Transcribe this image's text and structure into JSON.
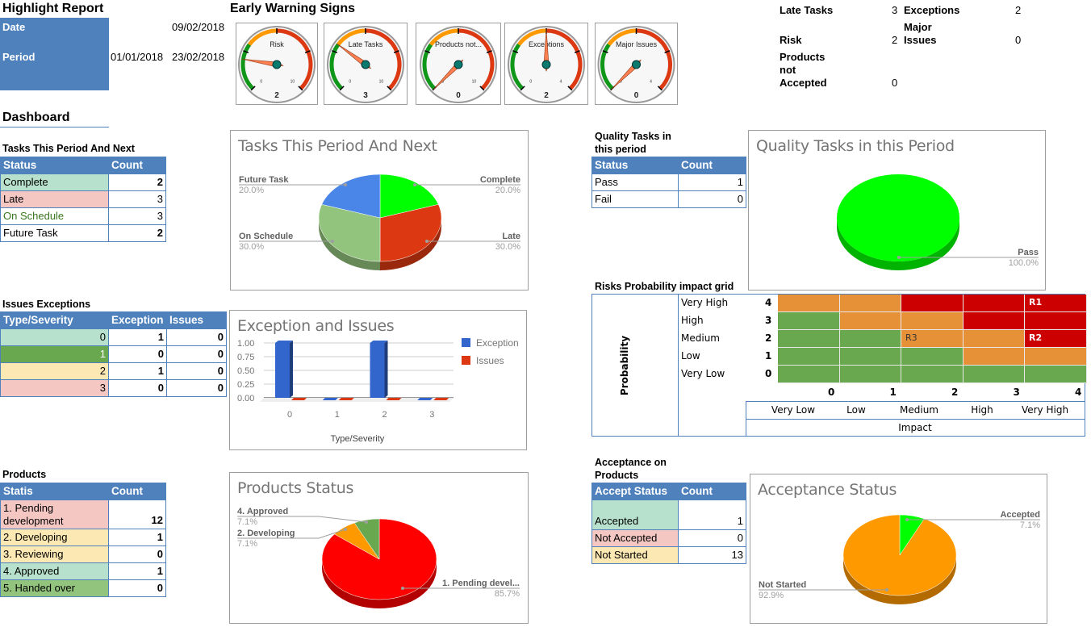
{
  "header": {
    "title": "Highlight Report",
    "date_label": "Date",
    "date_value": "09/02/2018",
    "period_label": "Period",
    "period_start": "01/01/2018",
    "period_end": "23/02/2018",
    "dashboard_label": "Dashboard"
  },
  "warning": {
    "title": "Early Warning Signs",
    "gauges": [
      {
        "label": "Risk",
        "value": 2,
        "display": "2",
        "min": 0,
        "max": 10,
        "min_label": "0",
        "max_label": "10"
      },
      {
        "label": "Late Tasks",
        "value": 3,
        "display": "3",
        "min": 0,
        "max": 10,
        "min_label": "0",
        "max_label": "10"
      },
      {
        "label": "Products not...",
        "value": 0,
        "display": "0",
        "min": 0,
        "max": 10,
        "min_label": "0",
        "max_label": "10"
      },
      {
        "label": "Exceptions",
        "value": 2,
        "display": "2",
        "min": 0,
        "max": 4,
        "min_label": "0",
        "max_label": "4"
      },
      {
        "label": "Major Issues",
        "value": 0,
        "display": "0",
        "min": 0,
        "max": 4,
        "min_label": "0",
        "max_label": "4"
      }
    ],
    "colors": {
      "green": "#109618",
      "orange": "#ff9900",
      "red": "#dc3912",
      "needle": "#ff7f50",
      "hub": "#0b7a6e"
    }
  },
  "summary": {
    "late_tasks_label": "Late Tasks",
    "late_tasks_value": "3",
    "exceptions_label": "Exceptions",
    "exceptions_value": "2",
    "risk_label": "Risk",
    "risk_value": "2",
    "major_label_1": "Major",
    "major_label_2": "Issues",
    "major_value": "0",
    "pna_label_1": "Products",
    "pna_label_2": "not",
    "pna_label_3": "Accepted",
    "pna_value": "0"
  },
  "tasks": {
    "title": "Tasks This Period And Next",
    "col_status": "Status",
    "col_count": "Count",
    "rows": [
      {
        "status": "Complete",
        "count": "2"
      },
      {
        "status": "Late",
        "count": "3"
      },
      {
        "status": "On Schedule",
        "count": "3"
      },
      {
        "status": "Future Task",
        "count": "2"
      }
    ]
  },
  "issues": {
    "title": "Issues Exceptions",
    "col_type": "Type/Severity",
    "col_exception": "Exception",
    "col_issues": "Issues",
    "rows": [
      {
        "type": "0",
        "exception": "1",
        "issues": "0"
      },
      {
        "type": "1",
        "exception": "0",
        "issues": "0"
      },
      {
        "type": "2",
        "exception": "1",
        "issues": "0"
      },
      {
        "type": "3",
        "exception": "0",
        "issues": "0"
      }
    ]
  },
  "products": {
    "title": "Products",
    "col_status": "Statis",
    "col_count": "Count",
    "rows": [
      {
        "status_1": "1. Pending",
        "status_2": "development",
        "count": "12"
      },
      {
        "status": "2. Developing",
        "count": "1"
      },
      {
        "status": "3. Reviewing",
        "count": "0"
      },
      {
        "status": "4. Approved",
        "count": "1"
      },
      {
        "status": "5. Handed over",
        "count": "0"
      }
    ]
  },
  "quality": {
    "title_1": "Quality Tasks in",
    "title_2": "this period",
    "col_status": "Status",
    "col_count": "Count",
    "rows": [
      {
        "status": "Pass",
        "count": "1"
      },
      {
        "status": "Fail",
        "count": "0"
      }
    ]
  },
  "risk_grid": {
    "title": "Risks Probability impact grid",
    "probability_label": "Probability",
    "impact_label": "Impact",
    "prob_levels": [
      "Very High",
      "High",
      "Medium",
      "Low",
      "Very Low"
    ],
    "prob_numbers": [
      "4",
      "3",
      "2",
      "1",
      "0"
    ],
    "impact_numbers": [
      "0",
      "1",
      "2",
      "3",
      "4"
    ],
    "impact_levels": [
      "Very Low",
      "Low",
      "Medium",
      "High",
      "Very High"
    ],
    "cells": [
      [
        "orange",
        "orange",
        "red",
        "red",
        "red"
      ],
      [
        "green",
        "orange",
        "orange",
        "red",
        "red"
      ],
      [
        "green",
        "green",
        "orange",
        "orange",
        "red"
      ],
      [
        "green",
        "green",
        "green",
        "orange",
        "orange"
      ],
      [
        "green",
        "green",
        "green",
        "green",
        "green"
      ]
    ],
    "markers": [
      {
        "id": "R1",
        "row": 0,
        "col": 4
      },
      {
        "id": "R3",
        "row": 2,
        "col": 2
      },
      {
        "id": "R2",
        "row": 2,
        "col": 4
      }
    ],
    "colors": {
      "green": "#6aa84f",
      "orange": "#e69138",
      "red": "#cc0000"
    }
  },
  "acceptance": {
    "title_1": "Acceptance on",
    "title_2": "Products",
    "col_status": "Accept Status",
    "col_count": "Count",
    "rows": [
      {
        "status": "Accepted",
        "count": "1"
      },
      {
        "status": "Not Accepted",
        "count": "0"
      },
      {
        "status": "Not Started",
        "count": "13"
      }
    ]
  },
  "chart_data": [
    {
      "id": "tasks-pie",
      "type": "pie",
      "title": "Tasks This Period And Next",
      "categories": [
        "Complete",
        "Late",
        "On Schedule",
        "Future Task"
      ],
      "values": [
        2,
        3,
        3,
        2
      ],
      "percent_labels": [
        "20.0%",
        "30.0%",
        "30.0%",
        "20.0%"
      ],
      "colors": [
        "#00ff00",
        "#dc3912",
        "#93c47d",
        "#4a86e8"
      ],
      "three_d": true
    },
    {
      "id": "exceptions-bar",
      "type": "bar",
      "title": "Exception and Issues",
      "categories": [
        "0",
        "1",
        "2",
        "3"
      ],
      "series": [
        {
          "name": "Exception",
          "values": [
            1,
            0,
            1,
            0
          ],
          "color": "#3366cc"
        },
        {
          "name": "Issues",
          "values": [
            0,
            0,
            0,
            0
          ],
          "color": "#dc3912"
        }
      ],
      "xlabel": "Type/Severity",
      "ylabel": "",
      "ylim": [
        0,
        1
      ],
      "yticks": [
        "0.00",
        "0.25",
        "0.50",
        "0.75",
        "1.00"
      ],
      "legend": "right",
      "grid": true,
      "three_d": true
    },
    {
      "id": "quality-pie",
      "type": "pie",
      "title": "Quality Tasks in this Period",
      "categories": [
        "Pass"
      ],
      "values": [
        1
      ],
      "percent_labels": [
        "100.0%"
      ],
      "colors": [
        "#00ff00"
      ],
      "three_d": true
    },
    {
      "id": "products-pie",
      "type": "pie",
      "title": "Products Status",
      "categories": [
        "1. Pending devel...",
        "2. Developing",
        "4. Approved"
      ],
      "values": [
        12,
        1,
        1
      ],
      "percent_labels": [
        "85.7%",
        "7.1%",
        "7.1%"
      ],
      "colors": [
        "#ff0000",
        "#ff9900",
        "#6aa84f"
      ],
      "three_d": true
    },
    {
      "id": "acceptance-pie",
      "type": "pie",
      "title": "Acceptance Status",
      "categories": [
        "Accepted",
        "Not Started"
      ],
      "values": [
        1,
        13
      ],
      "percent_labels": [
        "7.1%",
        "92.9%"
      ],
      "colors": [
        "#00ff00",
        "#ff9900"
      ],
      "three_d": true
    }
  ]
}
